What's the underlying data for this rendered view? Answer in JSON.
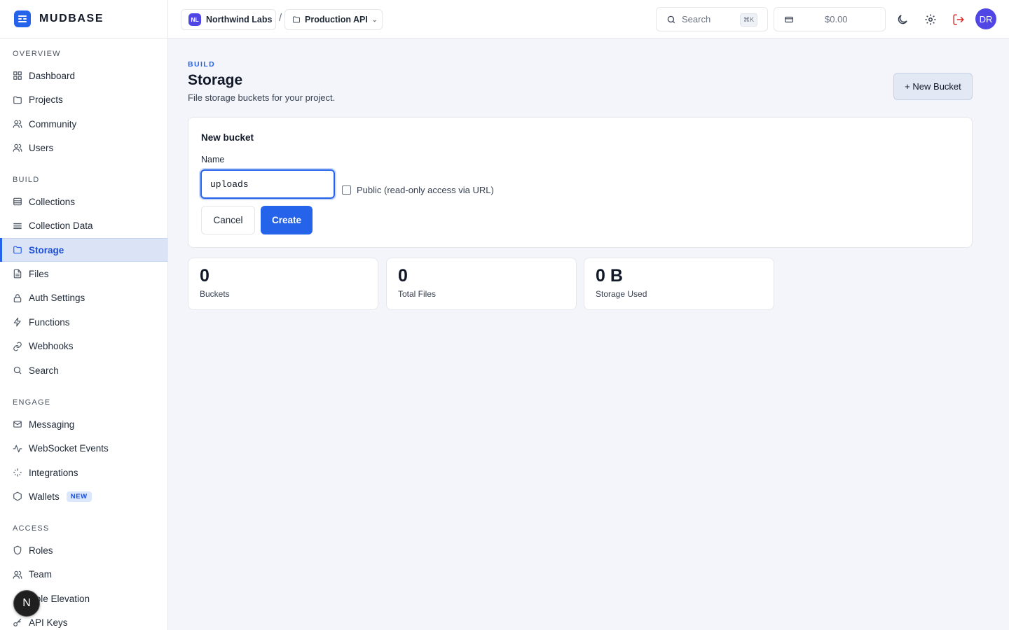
{
  "brand": {
    "name": "MUDBASE"
  },
  "sidebar": {
    "sections": [
      {
        "heading": "OVERVIEW",
        "items": [
          {
            "label": "Dashboard",
            "icon": "grid-icon"
          },
          {
            "label": "Projects",
            "icon": "folder-icon"
          },
          {
            "label": "Community",
            "icon": "users-icon"
          },
          {
            "label": "Users",
            "icon": "users-icon"
          }
        ]
      },
      {
        "heading": "BUILD",
        "items": [
          {
            "label": "Collections",
            "icon": "database-icon"
          },
          {
            "label": "Collection Data",
            "icon": "list-icon"
          },
          {
            "label": "Storage",
            "icon": "folder-icon",
            "active": true
          },
          {
            "label": "Files",
            "icon": "file-icon"
          },
          {
            "label": "Auth Settings",
            "icon": "lock-icon"
          },
          {
            "label": "Functions",
            "icon": "bolt-icon"
          },
          {
            "label": "Webhooks",
            "icon": "link-icon"
          },
          {
            "label": "Search",
            "icon": "search-icon"
          }
        ]
      },
      {
        "heading": "ENGAGE",
        "items": [
          {
            "label": "Messaging",
            "icon": "mail-icon"
          },
          {
            "label": "WebSocket Events",
            "icon": "activity-icon"
          },
          {
            "label": "Integrations",
            "icon": "sparkle-icon"
          },
          {
            "label": "Wallets",
            "icon": "hexagon-icon",
            "badge": "NEW"
          }
        ]
      },
      {
        "heading": "ACCESS",
        "items": [
          {
            "label": "Roles",
            "icon": "shield-icon"
          },
          {
            "label": "Team",
            "icon": "users-icon"
          },
          {
            "label": "Role Elevation",
            "icon": "arrow-up-icon"
          },
          {
            "label": "API Keys",
            "icon": "key-icon"
          }
        ]
      }
    ]
  },
  "floating": {
    "label": "N"
  },
  "topbar": {
    "org": {
      "initials": "NL",
      "name": "Northwind Labs"
    },
    "separator": "/",
    "project": {
      "name": "Production API"
    },
    "search": {
      "placeholder": "Search",
      "shortcut": "⌘K"
    },
    "balance": "$0.00",
    "avatar": "DR"
  },
  "page": {
    "eyebrow": "BUILD",
    "title": "Storage",
    "subtitle": "File storage buckets for your project.",
    "new_button": "+ New Bucket"
  },
  "form": {
    "title": "New bucket",
    "name_label": "Name",
    "name_value": "uploads",
    "public_label": "Public (read-only access via URL)",
    "public_checked": false,
    "cancel": "Cancel",
    "create": "Create"
  },
  "stats": [
    {
      "value": "0",
      "label": "Buckets"
    },
    {
      "value": "0",
      "label": "Total Files"
    },
    {
      "value": "0 B",
      "label": "Storage Used"
    }
  ],
  "colors": {
    "accent": "#2563eb",
    "active_bg": "#dbe4f6",
    "page_bg": "#f3f5fa"
  }
}
